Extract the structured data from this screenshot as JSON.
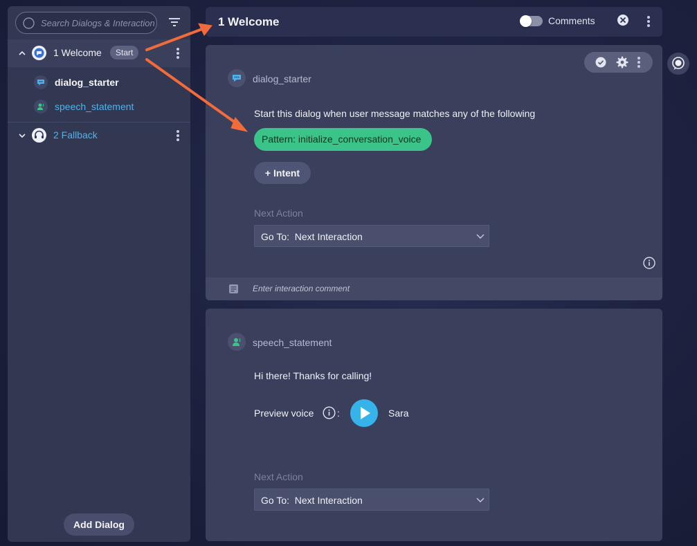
{
  "sidebar": {
    "search_placeholder": "Search Dialogs & Interactions",
    "dialogs": [
      {
        "label": "1 Welcome",
        "badge": "Start",
        "expanded": true,
        "interactions": [
          {
            "label": "dialog_starter",
            "icon": "chat-bubble-icon"
          },
          {
            "label": "speech_statement",
            "icon": "speaking-person-icon"
          }
        ]
      },
      {
        "label": "2 Fallback",
        "expanded": false,
        "icon": "headset-icon"
      }
    ],
    "add_dialog_label": "Add Dialog"
  },
  "header": {
    "title": "1 Welcome",
    "comments_label": "Comments",
    "comments_enabled": false
  },
  "cards": {
    "dialog_starter": {
      "type_label": "dialog_starter",
      "description": "Start this dialog when user message matches any of the following",
      "pattern_label": "Pattern:  initialize_conversation_voice",
      "intent_button": "+ Intent",
      "next_action_label": "Next Action",
      "next_action_value": "Go To:  Next Interaction",
      "comment_placeholder": "Enter interaction comment"
    },
    "speech_statement": {
      "type_label": "speech_statement",
      "message": "Hi there! Thanks for calling!",
      "preview_voice_label": "Preview voice",
      "colon": ":",
      "voice_name": "Sara",
      "next_action_label": "Next Action",
      "next_action_value": "Go To:  Next Interaction"
    }
  },
  "colors": {
    "pattern_bg": "#3ac48a",
    "play_bg": "#36b3e8",
    "link_blue": "#4fb3ea",
    "annotation_arrow": "#f26b3a"
  }
}
